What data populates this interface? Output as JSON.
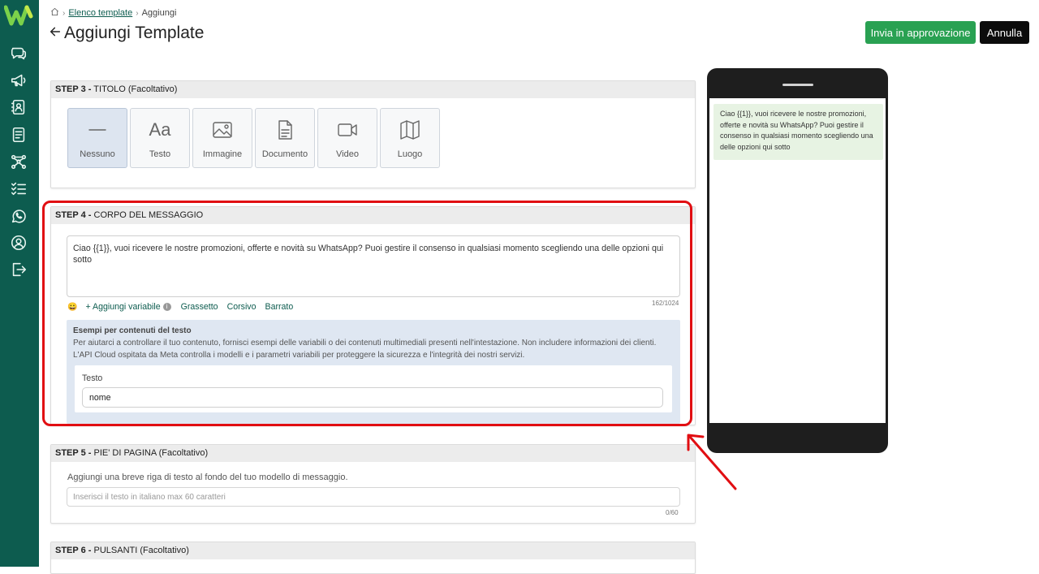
{
  "breadcrumb": {
    "parent": "Elenco template",
    "current": "Aggiungi"
  },
  "page": {
    "title": "Aggiungi Template"
  },
  "actions": {
    "approve": "Invia in approvazione",
    "cancel": "Annulla"
  },
  "step3": {
    "step": "STEP 3 -",
    "title": "TITOLO (Facoltativo)",
    "options": [
      {
        "label": "Nessuno",
        "icon": "dash-icon",
        "selected": true
      },
      {
        "label": "Testo",
        "icon": "text-aa-icon",
        "selected": false
      },
      {
        "label": "Immagine",
        "icon": "image-icon",
        "selected": false
      },
      {
        "label": "Documento",
        "icon": "document-icon",
        "selected": false
      },
      {
        "label": "Video",
        "icon": "video-icon",
        "selected": false
      },
      {
        "label": "Luogo",
        "icon": "map-icon",
        "selected": false
      }
    ],
    "text_icon_glyph": "Aa"
  },
  "step4": {
    "step": "STEP 4 -",
    "title": "CORPO DEL MESSAGGIO",
    "body": "Ciao {{1}}, vuoi ricevere le nostre promozioni, offerte e novità su WhatsApp? Puoi gestire il consenso in qualsiasi momento scegliendo una delle opzioni qui sotto",
    "toolbar": {
      "emoji": "😀",
      "add_variable": "+ Aggiungi variabile",
      "info": "i",
      "bold": "Grassetto",
      "italic": "Corsivo",
      "strike": "Barrato"
    },
    "counter": "162/1024",
    "examples": {
      "title": "Esempi per contenuti del testo",
      "description": "Per aiutarci a controllare il tuo contenuto, fornisci esempi delle variabili o dei contenuti multimediali presenti nell'intestazione. Non includere informazioni dei clienti. L'API Cloud ospitata da Meta controlla i modelli e i parametri variabili per proteggere la sicurezza e l'integrità dei nostri servizi.",
      "field_label": "Testo",
      "field_value": "nome"
    }
  },
  "step5": {
    "step": "STEP 5 -",
    "title": "PIE' DI PAGINA (Facoltativo)",
    "description": "Aggiungi una breve riga di testo al fondo del tuo modello di messaggio.",
    "placeholder": "Inserisci il testo in italiano max 60 caratteri",
    "counter": "0/60"
  },
  "step6": {
    "step": "STEP 6 -",
    "title": "PULSANTI (Facoltativo)"
  },
  "preview": {
    "message": "Ciao {{1}}, vuoi ricevere le nostre promozioni, offerte e novità su WhatsApp? Puoi gestire il consenso in qualsiasi momento scegliendo una delle opzioni qui sotto"
  },
  "sidebar": {
    "items": [
      {
        "icon": "chat-icon"
      },
      {
        "icon": "megaphone-icon"
      },
      {
        "icon": "contacts-icon"
      },
      {
        "icon": "templates-icon"
      },
      {
        "icon": "flow-icon"
      },
      {
        "icon": "checklist-icon"
      },
      {
        "icon": "whatsapp-icon"
      },
      {
        "icon": "user-icon"
      },
      {
        "icon": "logout-icon"
      }
    ]
  },
  "colors": {
    "sidebar": "#0d5c4f",
    "approve": "#29a152",
    "highlight": "#e10e12",
    "bubble": "#e7f3e3"
  }
}
